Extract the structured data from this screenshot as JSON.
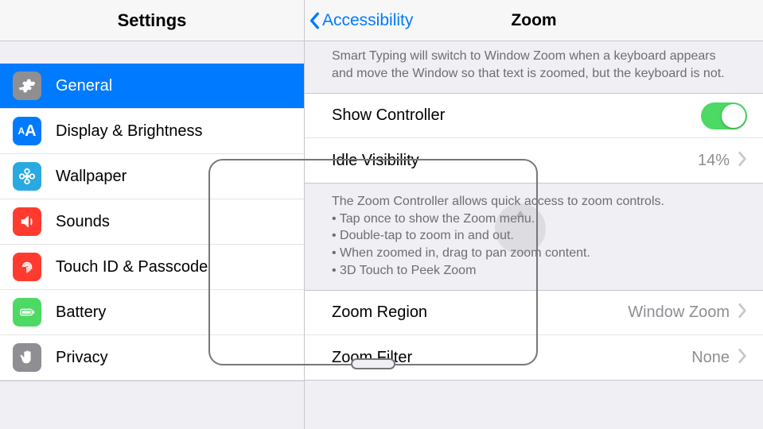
{
  "sidebar": {
    "title": "Settings",
    "items": [
      {
        "label": "General",
        "selected": true
      },
      {
        "label": "Display & Brightness"
      },
      {
        "label": "Wallpaper"
      },
      {
        "label": "Sounds"
      },
      {
        "label": "Touch ID & Passcode"
      },
      {
        "label": "Battery"
      },
      {
        "label": "Privacy"
      }
    ]
  },
  "detail": {
    "back_label": "Accessibility",
    "title": "Zoom",
    "smart_typing_note": "Smart Typing will switch to Window Zoom when a keyboard appears and move the Window so that text is zoomed, but the keyboard is not.",
    "show_controller": {
      "label": "Show Controller",
      "on": true
    },
    "idle_visibility": {
      "label": "Idle Visibility",
      "value": "14%"
    },
    "controller_note_header": "The Zoom Controller allows quick access to zoom controls.",
    "controller_note_b1": "• Tap once to show the Zoom menu.",
    "controller_note_b2": "• Double-tap to zoom in and out.",
    "controller_note_b3": "• When zoomed in, drag to pan zoom content.",
    "controller_note_b4": "• 3D Touch to Peek Zoom",
    "zoom_region": {
      "label": "Zoom Region",
      "value": "Window Zoom"
    },
    "zoom_filter": {
      "label": "Zoom Filter",
      "value": "None"
    }
  }
}
